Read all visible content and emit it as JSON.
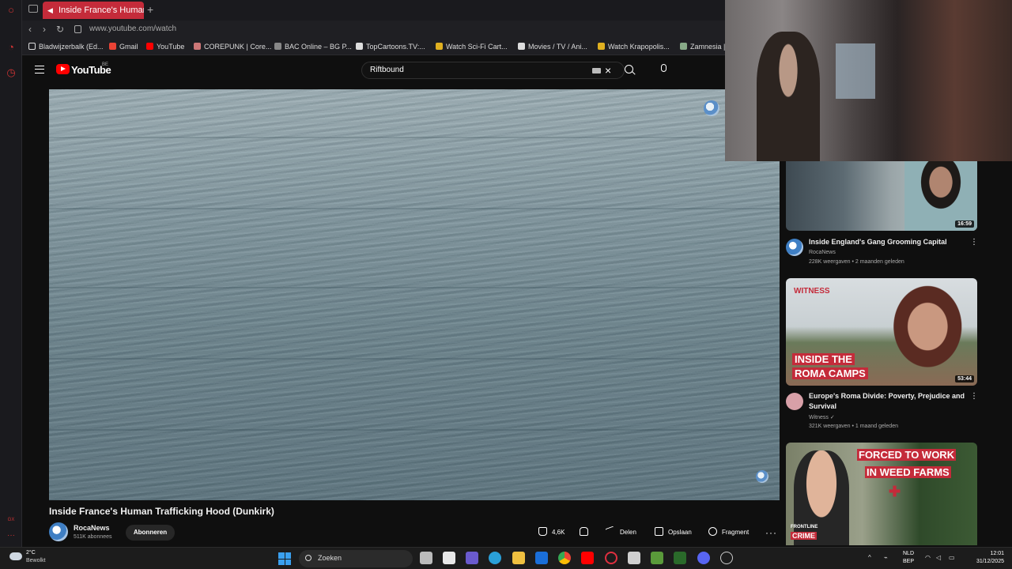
{
  "browser": {
    "tab_title": "Inside France's Human",
    "url": "www.youtube.com/watch",
    "bookmarks": [
      "Bladwijzerbalk (Ed...",
      "Gmail",
      "YouTube",
      "COREPUNK | Core...",
      "BAC Online – BG P...",
      "TopCartoons.TV:...",
      "Watch Sci-Fi Cart...",
      "Movies / TV / Ani...",
      "Watch Krapopolis...",
      "Zamnesia |"
    ],
    "sidebar_labels": [
      "GX"
    ]
  },
  "youtube": {
    "wordmark": "YouTube",
    "region": "BE",
    "search_query": "Riftbound"
  },
  "video": {
    "title": "Inside France's Human Trafficking Hood (Dunkirk)",
    "channel": "RocaNews",
    "subscribers": "511K abonnees",
    "subscribe_label": "Abonneren",
    "likes": "4,6K",
    "share_label": "Delen",
    "save_label": "Opslaan",
    "clip_label": "Fragment"
  },
  "recommendations": [
    {
      "title": "Inside England's Gang Grooming Capital",
      "channel": "RocaNews",
      "meta": "228K weergaven • 2 maanden geleden",
      "duration": "16:59"
    },
    {
      "title": "Europe's Roma Divide: Poverty, Prejudice and Survival",
      "channel": "Witness",
      "meta": "321K weergaven • 1 maand geleden",
      "duration": "53:44",
      "thumb_brand": "WITNESS",
      "thumb_text": [
        "INSIDE THE",
        "ROMA CAMPS"
      ]
    },
    {
      "thumb_text": [
        "FORCED TO WORK",
        "IN WEED FARMS"
      ],
      "thumb_badge": [
        "FRONTLINE",
        "CRIME"
      ]
    }
  ],
  "taskbar": {
    "temperature": "2°C",
    "weather": "Bewolkt",
    "search_label": "Zoeken",
    "lang_top": "NLD",
    "lang_bottom": "BEP",
    "time": "12:01",
    "date": "31/12/2025"
  },
  "colors": {
    "tab_active": "#c42b3a",
    "yt_red": "#ff0000",
    "background": "#0f0f0f"
  }
}
